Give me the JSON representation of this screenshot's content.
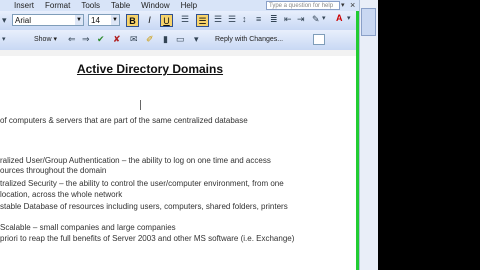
{
  "menu": [
    "Insert",
    "Format",
    "Tools",
    "Table",
    "Window",
    "Help"
  ],
  "help_placeholder": "Type a question for help",
  "font_name": "Arial",
  "font_size": "14",
  "format_buttons": [
    "B",
    "I",
    "U"
  ],
  "toolbar2": {
    "show_label": "Show ▾",
    "reply_label": "Reply with Changes..."
  },
  "document": {
    "title": "Active Directory Domains",
    "lines": [
      "of computers & servers that are part of the same centralized database",
      "ralized User/Group Authentication – the ability to log on one time and access",
      "ources throughout the domain",
      "tralized Security – the ability to control the user/computer environment, from one",
      "location, across the whole network",
      "stable Database of resources including users, computers, shared folders, printers",
      "Scalable – small companies and large companies",
      "priori to reap the full benefits of Server 2003 and other MS software (i.e. Exchange)"
    ]
  },
  "colors": {
    "toolbar": "#c8d8f4",
    "highlight": "#f7d36b",
    "margin_line": "#22cc33"
  }
}
